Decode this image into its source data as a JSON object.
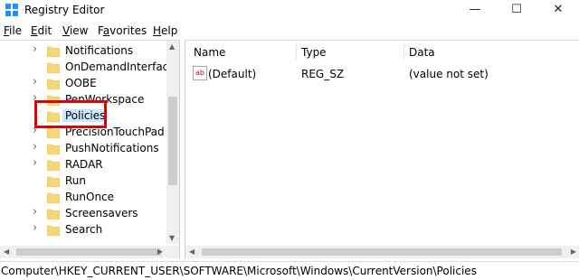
{
  "window": {
    "title": "Registry Editor",
    "min": "—",
    "max": "☐",
    "close": "✕"
  },
  "menu": [
    {
      "label": "File",
      "key": "F",
      "rest": "ile"
    },
    {
      "label": "Edit",
      "key": "E",
      "rest": "dit"
    },
    {
      "label": "View",
      "key": "V",
      "rest": "iew"
    },
    {
      "label": "Favorites",
      "key": "a",
      "pre": "F",
      "rest": "vorites"
    },
    {
      "label": "Help",
      "key": "H",
      "rest": "elp"
    }
  ],
  "tree": [
    {
      "label": "Notifications",
      "expandable": true
    },
    {
      "label": "OnDemandInterfaceC",
      "expandable": false
    },
    {
      "label": "OOBE",
      "expandable": true
    },
    {
      "label": "PenWorkspace",
      "expandable": true
    },
    {
      "label": "Policies",
      "expandable": false,
      "selected": true
    },
    {
      "label": "PrecisionTouchPad",
      "expandable": true
    },
    {
      "label": "PushNotifications",
      "expandable": true
    },
    {
      "label": "RADAR",
      "expandable": true
    },
    {
      "label": "Run",
      "expandable": false
    },
    {
      "label": "RunOnce",
      "expandable": false
    },
    {
      "label": "Screensavers",
      "expandable": true
    },
    {
      "label": "Search",
      "expandable": true
    }
  ],
  "list": {
    "headers": {
      "name": "Name",
      "type": "Type",
      "data": "Data"
    },
    "rows": [
      {
        "name": "(Default)",
        "type": "REG_SZ",
        "data": "(value not set)",
        "icon": "ab"
      }
    ]
  },
  "status": "Computer\\HKEY_CURRENT_USER\\SOFTWARE\\Microsoft\\Windows\\CurrentVersion\\Policies",
  "colors": {
    "highlight": "#e00000",
    "selection": "#cce8ff",
    "folder": "#f8d775"
  }
}
